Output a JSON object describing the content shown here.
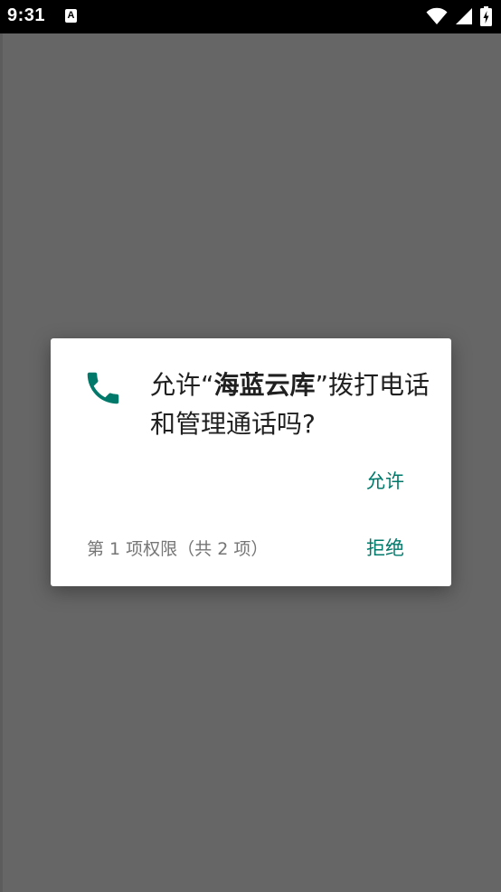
{
  "status_bar": {
    "time": "9:31",
    "notification_icon": "a-icon",
    "icons": [
      "wifi-icon",
      "signal-icon",
      "battery-charging-icon"
    ]
  },
  "dialog": {
    "icon": "phone-icon",
    "icon_color": "#00796B",
    "title_prefix": "允许“",
    "app_name": "海蓝云库",
    "title_suffix": "”拨打电话和管理通话吗?",
    "allow_label": "允许",
    "deny_label": "拒绝",
    "permission_counter": "第 1 项权限（共 2 项）"
  },
  "colors": {
    "accent": "#00796B",
    "scrim": "#666666",
    "status_bar": "#000000"
  }
}
